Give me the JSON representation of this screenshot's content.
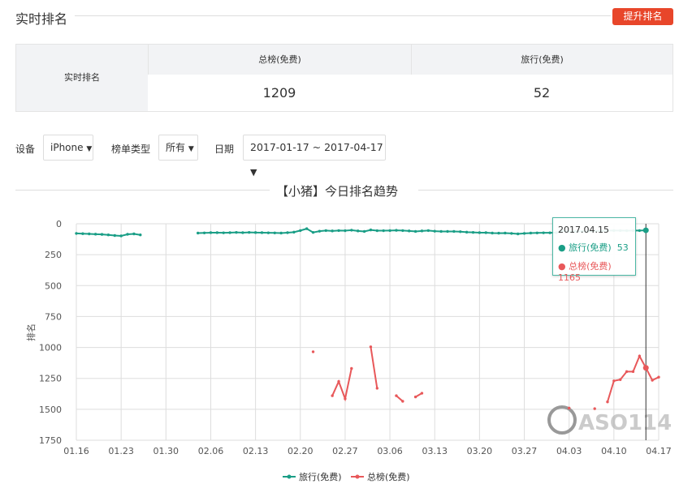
{
  "header": {
    "title": "实时排名",
    "boost_button": "提升排名"
  },
  "rank_table": {
    "row_label": "实时排名",
    "columns": [
      {
        "label": "总榜(免费)",
        "value": "1209"
      },
      {
        "label": "旅行(免费)",
        "value": "52"
      }
    ]
  },
  "filters": {
    "device_label": "设备",
    "device_value": "iPhone",
    "list_type_label": "榜单类型",
    "list_type_value": "所有",
    "date_label": "日期",
    "date_value": "2017-01-17 ~ 2017-04-17"
  },
  "chart_title": "【小猪】今日排名趋势",
  "tooltip": {
    "date": "2017.04.15",
    "rows": [
      {
        "name": "旅行(免费)",
        "value": "53",
        "color": "#1a9e86"
      },
      {
        "name": "总榜(免费)",
        "value": "1165",
        "color": "#e8585a"
      }
    ]
  },
  "watermark": "ASO114",
  "chart_data": {
    "type": "line",
    "ylabel": "排名",
    "yreversed": true,
    "ylim": [
      0,
      1750
    ],
    "yticks": [
      0,
      250,
      500,
      750,
      1000,
      1250,
      1500,
      1750
    ],
    "xticks": [
      "01.16",
      "01.23",
      "01.30",
      "02.06",
      "02.13",
      "02.20",
      "02.27",
      "03.06",
      "03.13",
      "03.20",
      "03.27",
      "04.03",
      "04.10",
      "04.17"
    ],
    "grid": true,
    "legend": "bottom",
    "x": [
      "01.16",
      "01.17",
      "01.18",
      "01.19",
      "01.20",
      "01.21",
      "01.22",
      "01.23",
      "01.24",
      "01.25",
      "01.26",
      "01.27",
      "01.28",
      "01.29",
      "01.30",
      "01.31",
      "02.01",
      "02.02",
      "02.03",
      "02.04",
      "02.05",
      "02.06",
      "02.07",
      "02.08",
      "02.09",
      "02.10",
      "02.11",
      "02.12",
      "02.13",
      "02.14",
      "02.15",
      "02.16",
      "02.17",
      "02.18",
      "02.19",
      "02.20",
      "02.21",
      "02.22",
      "02.23",
      "02.24",
      "02.25",
      "02.26",
      "02.27",
      "02.28",
      "03.01",
      "03.02",
      "03.03",
      "03.04",
      "03.05",
      "03.06",
      "03.07",
      "03.08",
      "03.09",
      "03.10",
      "03.11",
      "03.12",
      "03.13",
      "03.14",
      "03.15",
      "03.16",
      "03.17",
      "03.18",
      "03.19",
      "03.20",
      "03.21",
      "03.22",
      "03.23",
      "03.24",
      "03.25",
      "03.26",
      "03.27",
      "03.28",
      "03.29",
      "03.30",
      "03.31",
      "04.01",
      "04.02",
      "04.03",
      "04.04",
      "04.05",
      "04.06",
      "04.07",
      "04.08",
      "04.09",
      "04.10",
      "04.11",
      "04.12",
      "04.13",
      "04.14",
      "04.15",
      "04.16",
      "04.17"
    ],
    "series": [
      {
        "name": "旅行(免费)",
        "color": "#1a9e86",
        "values": [
          78,
          80,
          82,
          84,
          86,
          90,
          95,
          98,
          85,
          82,
          90,
          null,
          null,
          null,
          null,
          null,
          null,
          null,
          null,
          75,
          74,
          72,
          72,
          73,
          72,
          70,
          72,
          70,
          71,
          72,
          73,
          74,
          75,
          72,
          68,
          55,
          40,
          70,
          60,
          55,
          58,
          55,
          56,
          52,
          58,
          62,
          50,
          56,
          56,
          55,
          53,
          55,
          58,
          62,
          58,
          55,
          60,
          62,
          62,
          62,
          64,
          68,
          70,
          72,
          72,
          75,
          76,
          75,
          78,
          82,
          78,
          75,
          74,
          73,
          73,
          72,
          58,
          62,
          62,
          62,
          60,
          58,
          58,
          55,
          55,
          55,
          56,
          55,
          55,
          53,
          null,
          null
        ]
      },
      {
        "name": "总榜(免费)",
        "color": "#e8585a",
        "values": [
          null,
          null,
          null,
          null,
          null,
          null,
          null,
          null,
          null,
          null,
          null,
          null,
          null,
          null,
          null,
          null,
          null,
          null,
          null,
          null,
          null,
          null,
          null,
          null,
          null,
          null,
          null,
          null,
          null,
          null,
          null,
          null,
          null,
          null,
          null,
          null,
          null,
          1035,
          null,
          null,
          1390,
          1275,
          1415,
          1170,
          null,
          null,
          995,
          1330,
          null,
          null,
          1390,
          1435,
          null,
          1400,
          1370,
          null,
          null,
          null,
          null,
          null,
          null,
          null,
          null,
          null,
          null,
          null,
          null,
          null,
          null,
          null,
          null,
          null,
          null,
          null,
          null,
          null,
          null,
          1490,
          null,
          null,
          null,
          1495,
          null,
          1440,
          1270,
          1260,
          1195,
          1195,
          1070,
          1165,
          1265,
          1240
        ]
      }
    ]
  }
}
